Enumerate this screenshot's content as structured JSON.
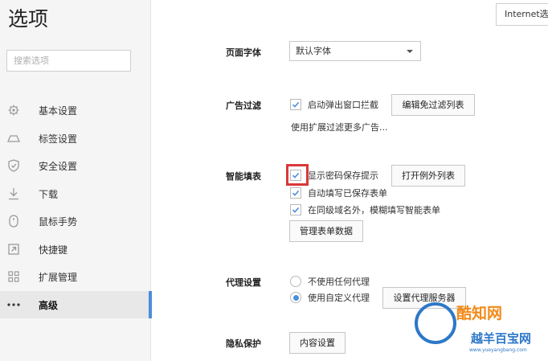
{
  "header": {
    "title": "选项",
    "top_button": "Internet选项"
  },
  "search": {
    "placeholder": "搜索选项"
  },
  "sidebar": {
    "items": [
      {
        "label": "基本设置",
        "icon": "gear-icon"
      },
      {
        "label": "标签设置",
        "icon": "tab-icon"
      },
      {
        "label": "安全设置",
        "icon": "shield-icon"
      },
      {
        "label": "下载",
        "icon": "download-icon"
      },
      {
        "label": "鼠标手势",
        "icon": "mouse-icon"
      },
      {
        "label": "快捷键",
        "icon": "shortcut-icon"
      },
      {
        "label": "扩展管理",
        "icon": "extension-icon"
      },
      {
        "label": "高级",
        "icon": "more-icon",
        "active": true
      }
    ]
  },
  "font_section": {
    "label": "页面字体",
    "value": "默认字体"
  },
  "ad_section": {
    "label": "广告过滤",
    "popup_block": {
      "label": "启动弹出窗口拦截",
      "checked": true
    },
    "edit_button": "编辑免过滤列表",
    "hint": "使用扩展过滤更多广告..."
  },
  "autofill_section": {
    "label": "智能填表",
    "show_password_prompt": {
      "label": "显示密码保存提示",
      "checked": true
    },
    "exceptions_button": "打开例外列表",
    "autofill_saved": {
      "label": "自动填写已保存表单",
      "checked": true
    },
    "fuzzy_fill": {
      "label": "在同级域名外，模糊填写智能表单",
      "checked": true
    },
    "manage_button": "管理表单数据"
  },
  "proxy_section": {
    "label": "代理设置",
    "no_proxy": {
      "label": "不使用任何代理",
      "selected": false
    },
    "custom_proxy": {
      "label": "使用自定义代理",
      "selected": true
    },
    "proxy_button": "设置代理服务器"
  },
  "privacy_section": {
    "label": "隐私保护",
    "content_button": "内容设置"
  },
  "watermark": {
    "brand": "酷知网",
    "brand2": "越羊百宝网",
    "url": "www.yueyangbang.com"
  },
  "colors": {
    "accent": "#4a8ede",
    "highlight": "#d9383a",
    "sidebar_bg": "#f5f5f5"
  }
}
